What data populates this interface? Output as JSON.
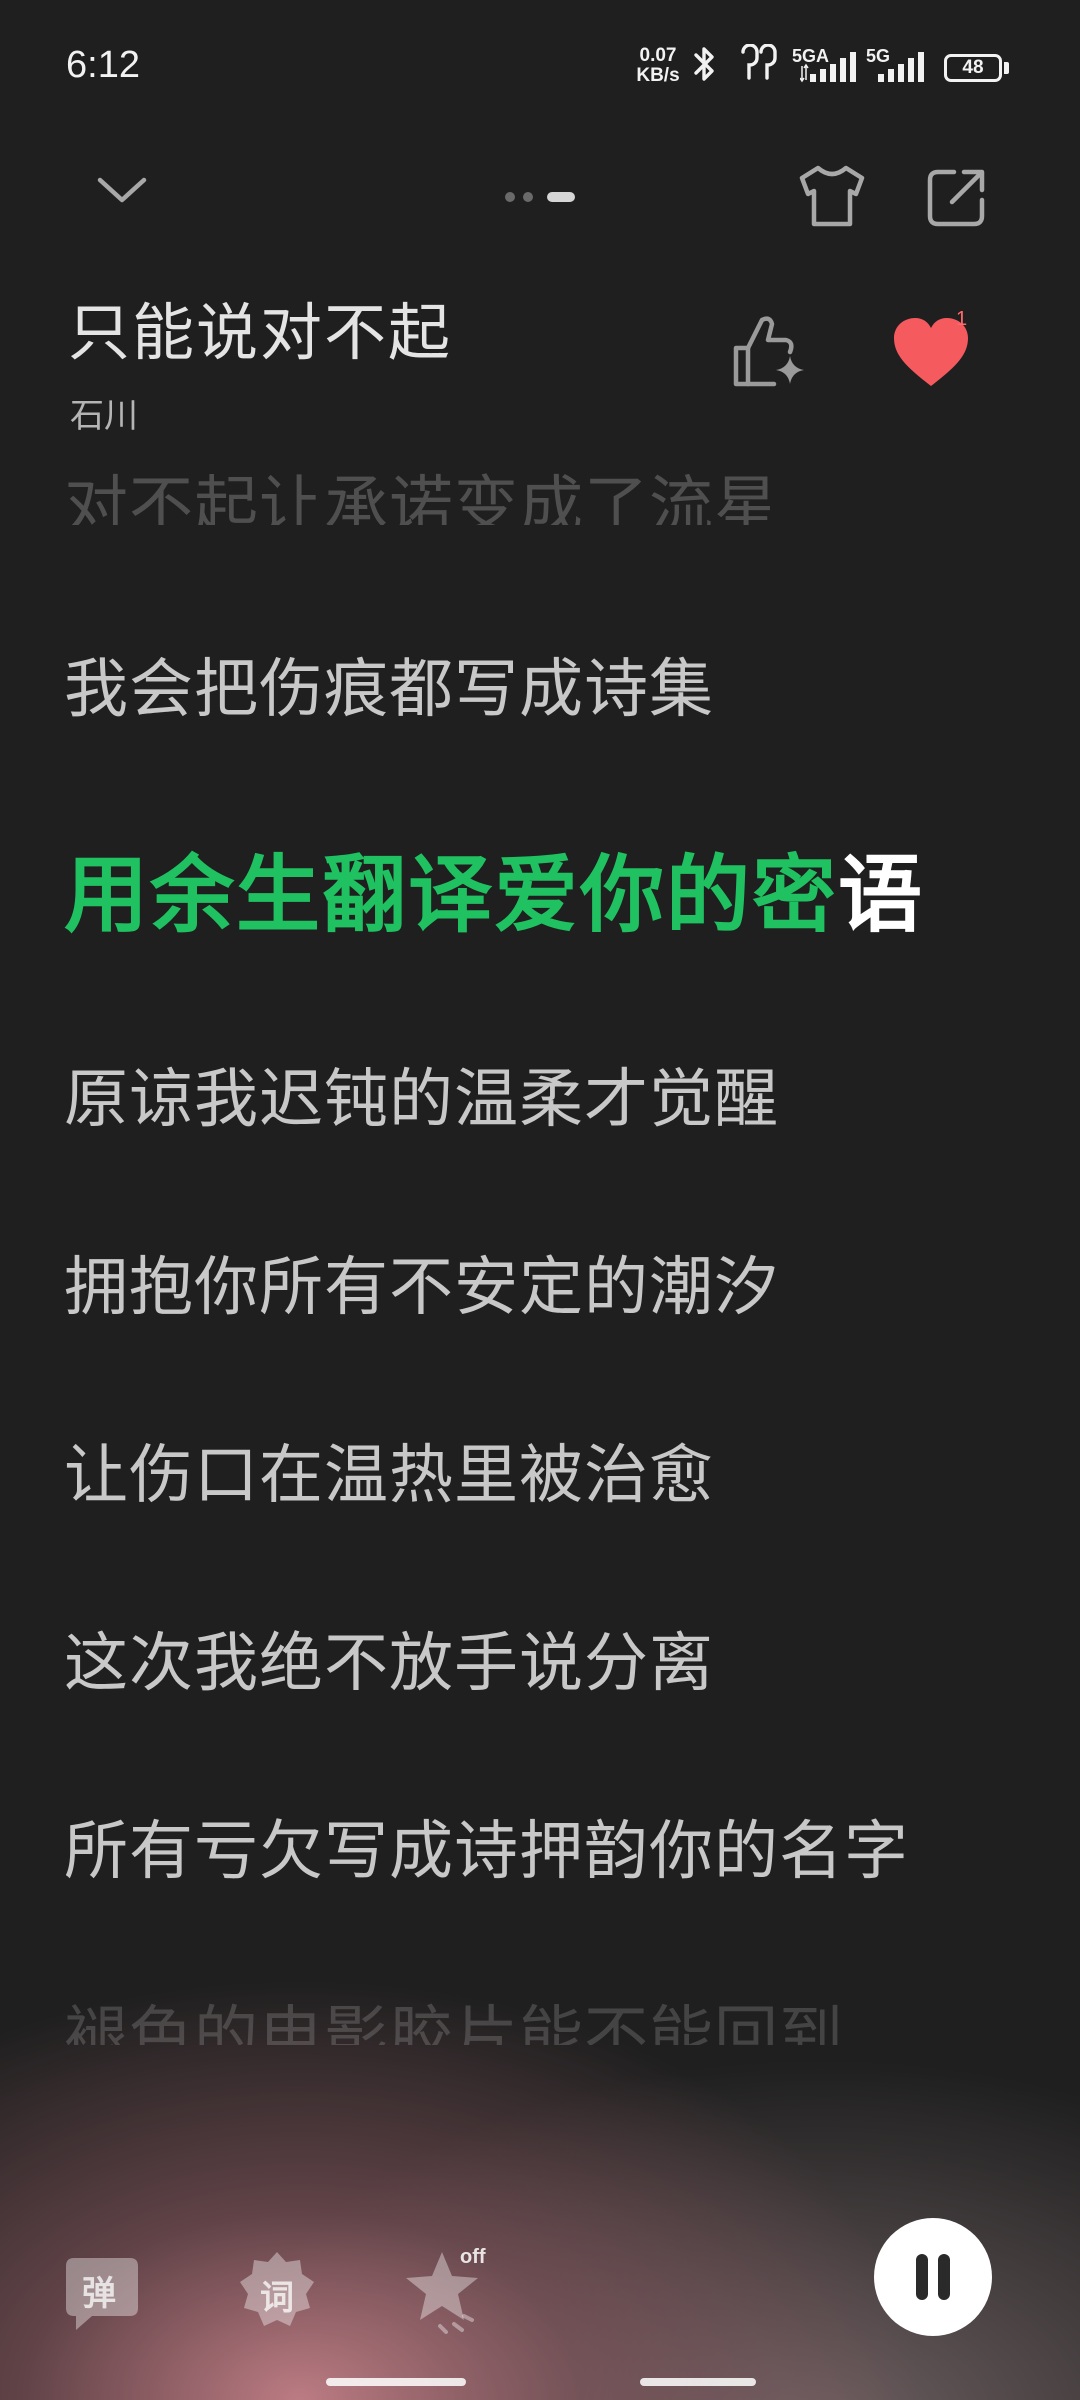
{
  "status_bar": {
    "time": "6:12",
    "net_speed_value": "0.07",
    "net_speed_unit": "KB/s",
    "sim1_label": "5GA",
    "sim2_label": "5G",
    "battery": "48"
  },
  "player": {
    "song_title": "只能说对不起",
    "artist": "石川",
    "like_count": "1"
  },
  "lyrics": {
    "prev_faded": "对不起让承诺变成了流星",
    "line_prev": "我会把伤痕都写成诗集",
    "current_sung": "用余生翻译爱你的密",
    "current_unsung": "语",
    "line_1": "原谅我迟钝的温柔才觉醒",
    "line_2": "拥抱你所有不安定的潮汐",
    "line_3": "让伤口在温热里被治愈",
    "line_4": "这次我绝不放手说分离",
    "line_5": "所有亏欠写成诗押韵你的名字",
    "next_faded": "褪色的电影胶片能不能回到"
  },
  "controls": {
    "danmaku_label": "弹",
    "lyrics_label": "词",
    "effect_state": "off"
  },
  "colors": {
    "accent_green": "#1fc161",
    "heart_red": "#f55a5f"
  }
}
